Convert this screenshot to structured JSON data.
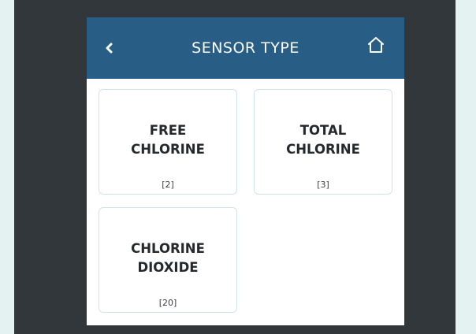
{
  "header": {
    "title": "SENSOR TYPE",
    "back_icon": "chevron-left-icon",
    "home_icon": "home-icon",
    "background_color": "#285d85"
  },
  "tiles": [
    {
      "line1": "FREE",
      "line2": "CHLORINE",
      "code": "[2]"
    },
    {
      "line1": "TOTAL",
      "line2": "CHLORINE",
      "code": "[3]"
    },
    {
      "line1": "CHLORINE",
      "line2": "DIOXIDE",
      "code": "[20]"
    }
  ]
}
